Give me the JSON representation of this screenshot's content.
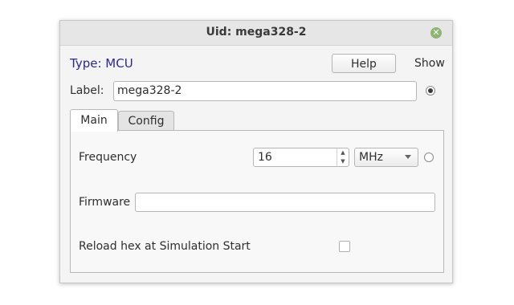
{
  "window": {
    "title": "Uid: mega328-2"
  },
  "header": {
    "type_label": "Type: MCU",
    "help_label": "Help",
    "show_label": "Show"
  },
  "label_row": {
    "label": "Label:",
    "value": "mega328-2"
  },
  "tabs": [
    {
      "label": "Main",
      "active": true
    },
    {
      "label": "Config",
      "active": false
    }
  ],
  "main": {
    "frequency": {
      "label": "Frequency",
      "value": "16",
      "unit": "MHz"
    },
    "firmware": {
      "label": "Firmware",
      "value": ""
    },
    "reload": {
      "label": "Reload hex at Simulation Start",
      "checked": false
    }
  },
  "icons": {
    "close": "close-icon",
    "spin_up": "arrow-up-icon",
    "spin_down": "arrow-down-icon",
    "dropdown": "chevron-down-icon"
  },
  "colors": {
    "type_label": "#2b2b86",
    "close_button": "#8fb573"
  }
}
